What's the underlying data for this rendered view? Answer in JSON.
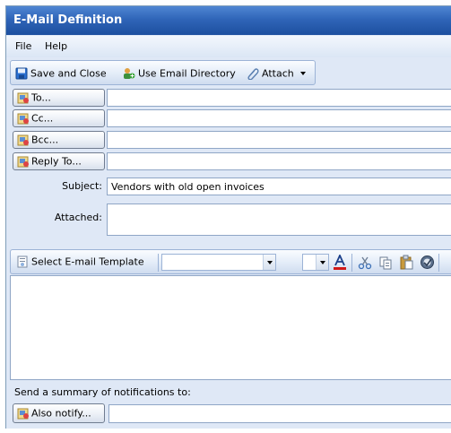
{
  "window": {
    "title": "E-Mail Definition"
  },
  "menu": {
    "items": [
      "File",
      "Help"
    ]
  },
  "toolbar": {
    "save_close": "Save and Close",
    "use_directory": "Use Email Directory",
    "attach": "Attach"
  },
  "fields": {
    "to_label": "To...",
    "cc_label": "Cc...",
    "bcc_label": "Bcc...",
    "reply_to_label": "Reply To...",
    "to_value": "",
    "cc_value": "",
    "bcc_value": "",
    "reply_to_value": "",
    "subject_label": "Subject:",
    "subject_value": "Vendors with old open invoices",
    "attached_label": "Attached:"
  },
  "format_toolbar": {
    "select_template": "Select E-mail Template",
    "font_value": "",
    "size_value": ""
  },
  "body": {
    "value": ""
  },
  "notify": {
    "summary_label": "Send a summary of notifications to:",
    "also_notify": "Also notify...",
    "value": ""
  },
  "colors": {
    "title_bar": "#2f65b8",
    "window_bg": "#dfe8f6",
    "font_color_red": "#d01818"
  },
  "icons": [
    "save-icon",
    "directory-icon",
    "attach-icon",
    "address-book-icon",
    "template-icon",
    "font-color-icon",
    "cut-icon",
    "copy-icon",
    "paste-icon",
    "spell-check-icon"
  ]
}
